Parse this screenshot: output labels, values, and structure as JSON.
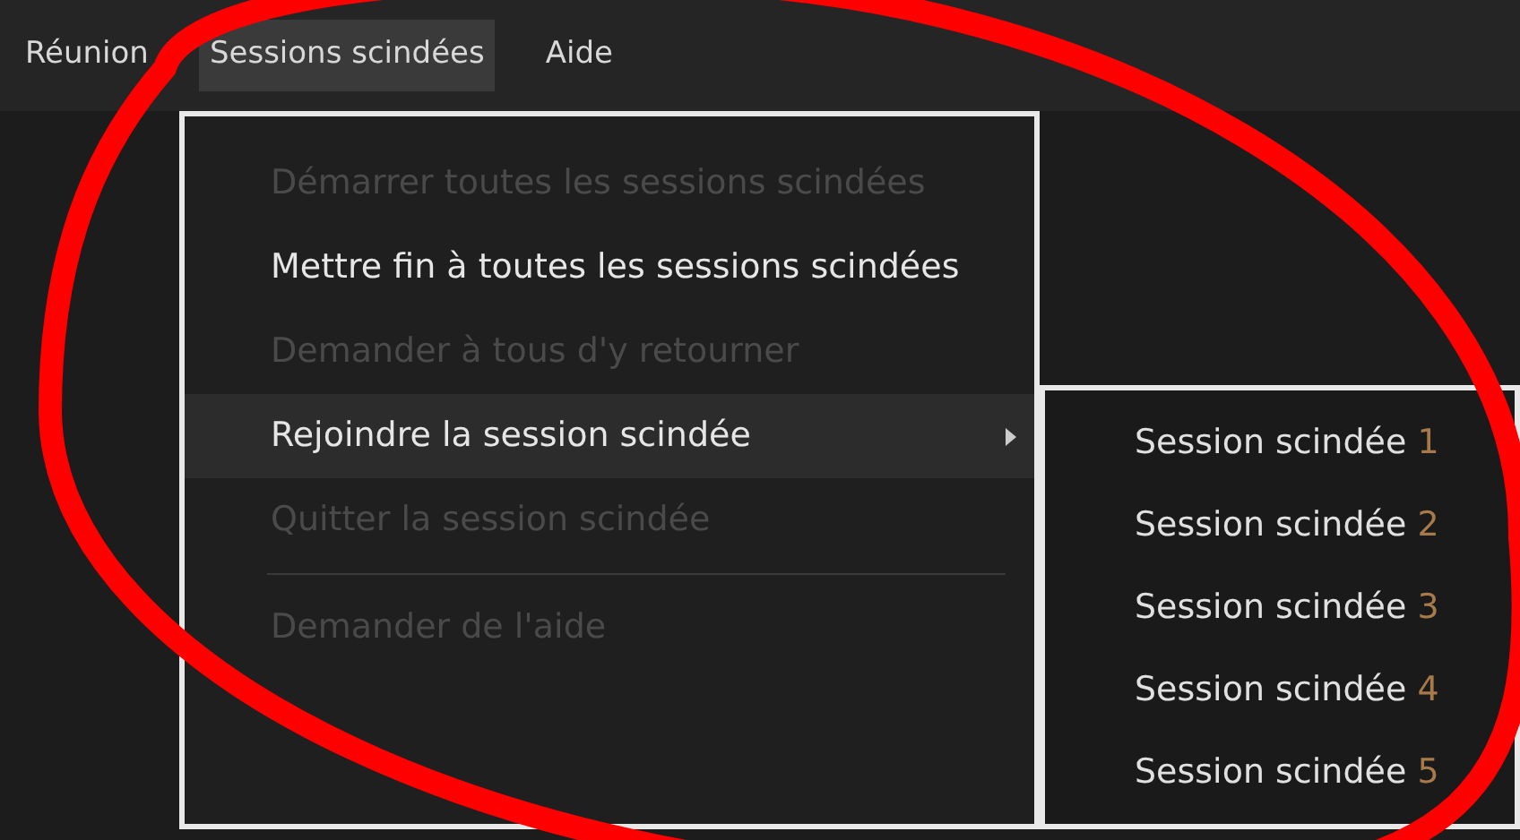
{
  "menubar": [
    {
      "label": "Réunion",
      "selected": false
    },
    {
      "label": "Sessions scindées",
      "selected": true
    },
    {
      "label": "Aide",
      "selected": false
    }
  ],
  "menu": [
    {
      "kind": "item",
      "label": "Démarrer toutes les sessions scindées",
      "disabled": true,
      "highlighted": false,
      "submenu": false
    },
    {
      "kind": "item",
      "label": "Mettre fin à toutes les sessions scindées",
      "disabled": false,
      "highlighted": false,
      "submenu": false
    },
    {
      "kind": "item",
      "label": "Demander à tous d'y retourner",
      "disabled": true,
      "highlighted": false,
      "submenu": false
    },
    {
      "kind": "item",
      "label": "Rejoindre la session scindée",
      "disabled": false,
      "highlighted": true,
      "submenu": true
    },
    {
      "kind": "item",
      "label": "Quitter la session scindée",
      "disabled": true,
      "highlighted": false,
      "submenu": false
    },
    {
      "kind": "separator"
    },
    {
      "kind": "item",
      "label": "Demander de l'aide",
      "disabled": true,
      "highlighted": false,
      "submenu": false
    }
  ],
  "submenu": [
    {
      "label": "Session scindée",
      "number": "1"
    },
    {
      "label": "Session scindée",
      "number": "2"
    },
    {
      "label": "Session scindée",
      "number": "3"
    },
    {
      "label": "Session scindée",
      "number": "4"
    },
    {
      "label": "Session scindée",
      "number": "5"
    }
  ]
}
